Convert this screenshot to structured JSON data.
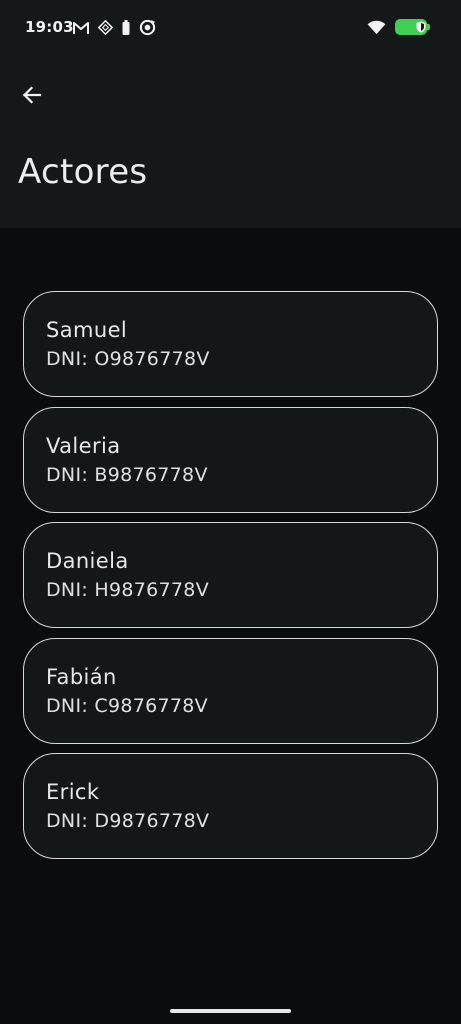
{
  "status_bar": {
    "time": "19:03",
    "left_icons": [
      "gmail-icon",
      "app-notification-icon",
      "battery-saver-icon",
      "sync-icon"
    ],
    "right_icons": [
      "wifi-icon",
      "battery-icon"
    ],
    "battery_color": "#3fcf55"
  },
  "header": {
    "back_icon": "arrow-left-icon",
    "title": "Actores"
  },
  "actors": [
    {
      "name": "Samuel",
      "dni": "DNI: O9876778V"
    },
    {
      "name": "Valeria",
      "dni": "DNI: B9876778V"
    },
    {
      "name": "Daniela",
      "dni": "DNI: H9876778V"
    },
    {
      "name": "Fabián",
      "dni": "DNI: C9876778V"
    },
    {
      "name": "Erick",
      "dni": "DNI: D9876778V"
    }
  ],
  "colors": {
    "background": "#0b0c0d",
    "header_background": "#151819",
    "card_border": "#d8d8d8",
    "text": "#e6e6e6"
  }
}
